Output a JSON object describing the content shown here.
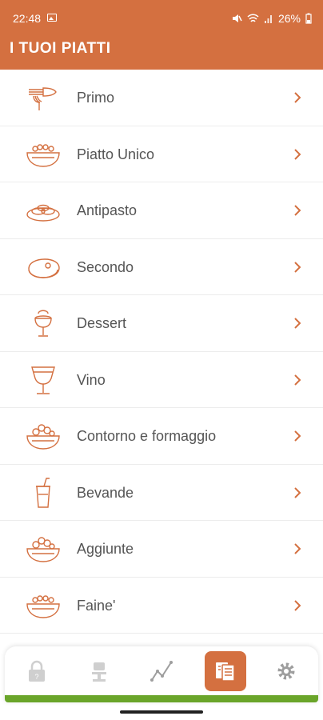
{
  "status_bar": {
    "time": "22:48",
    "battery": "26%"
  },
  "app_bar": {
    "title": "I TUOI PIATTI"
  },
  "categories": [
    {
      "label": "Primo",
      "icon": "pasta-fork-icon"
    },
    {
      "label": "Piatto Unico",
      "icon": "bowl-icon"
    },
    {
      "label": "Antipasto",
      "icon": "appetizer-plate-icon"
    },
    {
      "label": "Secondo",
      "icon": "steak-icon"
    },
    {
      "label": "Dessert",
      "icon": "dessert-cup-icon"
    },
    {
      "label": "Vino",
      "icon": "wine-glass-icon"
    },
    {
      "label": "Contorno e formaggio",
      "icon": "salad-bowl-icon"
    },
    {
      "label": "Bevande",
      "icon": "drink-cup-icon"
    },
    {
      "label": "Aggiunte",
      "icon": "salad-bowl-icon"
    },
    {
      "label": "Faine'",
      "icon": "bowl-icon"
    }
  ],
  "bottom_nav": [
    {
      "icon": "lock-icon",
      "active": false
    },
    {
      "icon": "chef-hat-icon",
      "active": false
    },
    {
      "icon": "chart-line-icon",
      "active": false
    },
    {
      "icon": "menu-card-icon",
      "active": true
    },
    {
      "icon": "gear-icon",
      "active": false
    }
  ],
  "colors": {
    "primary": "#d47040",
    "accent_green": "#6aa52a",
    "text": "#555555"
  }
}
